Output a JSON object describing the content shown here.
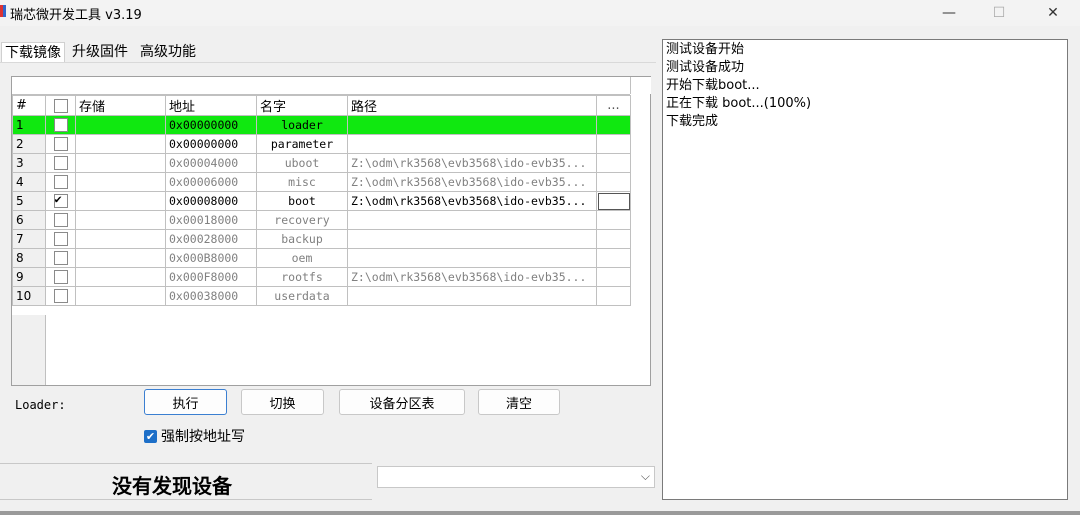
{
  "window": {
    "title": "瑞芯微开发工具 v3.19",
    "minimize_glyph": "—",
    "maximize_glyph": "☐",
    "close_glyph": "✕"
  },
  "tabs": [
    {
      "label": "下载镜像",
      "active": true
    },
    {
      "label": "升级固件",
      "active": false
    },
    {
      "label": "高级功能",
      "active": false
    }
  ],
  "grid": {
    "headers": {
      "num": "#",
      "check": "",
      "storage": "存储",
      "address": "地址",
      "name": "名字",
      "path": "路径",
      "more": "..."
    },
    "rows": [
      {
        "num": "1",
        "checked": false,
        "address": "0x00000000",
        "name": "loader",
        "path": "",
        "selected": true,
        "active": true
      },
      {
        "num": "2",
        "checked": false,
        "address": "0x00000000",
        "name": "parameter",
        "path": "",
        "selected": false,
        "active": true
      },
      {
        "num": "3",
        "checked": false,
        "address": "0x00004000",
        "name": "uboot",
        "path": "Z:\\odm\\rk3568\\evb3568\\ido-evb35...",
        "selected": false,
        "active": false
      },
      {
        "num": "4",
        "checked": false,
        "address": "0x00006000",
        "name": "misc",
        "path": "Z:\\odm\\rk3568\\evb3568\\ido-evb35...",
        "selected": false,
        "active": false
      },
      {
        "num": "5",
        "checked": true,
        "address": "0x00008000",
        "name": "boot",
        "path": "Z:\\odm\\rk3568\\evb3568\\ido-evb35...",
        "selected": false,
        "active": true
      },
      {
        "num": "6",
        "checked": false,
        "address": "0x00018000",
        "name": "recovery",
        "path": "",
        "selected": false,
        "active": false
      },
      {
        "num": "7",
        "checked": false,
        "address": "0x00028000",
        "name": "backup",
        "path": "",
        "selected": false,
        "active": false
      },
      {
        "num": "8",
        "checked": false,
        "address": "0x000B8000",
        "name": "oem",
        "path": "",
        "selected": false,
        "active": false
      },
      {
        "num": "9",
        "checked": false,
        "address": "0x000F8000",
        "name": "rootfs",
        "path": "Z:\\odm\\rk3568\\evb3568\\ido-evb35...",
        "selected": false,
        "active": false
      },
      {
        "num": "10",
        "checked": false,
        "address": "0x00038000",
        "name": "userdata",
        "path": "",
        "selected": false,
        "active": false
      }
    ]
  },
  "loader_label": "Loader:",
  "buttons": {
    "run": "执行",
    "switch": "切换",
    "partition": "设备分区表",
    "clear": "清空"
  },
  "force_address": {
    "label": "强制按地址写",
    "checked": true
  },
  "status": "没有发现设备",
  "combo_value": "",
  "log": [
    "测试设备开始",
    "测试设备成功",
    "开始下载boot...",
    "正在下载 boot...(100%)",
    "下载完成"
  ],
  "colors": {
    "selected_row": "#10e810",
    "accent": "#1d6fc8"
  }
}
